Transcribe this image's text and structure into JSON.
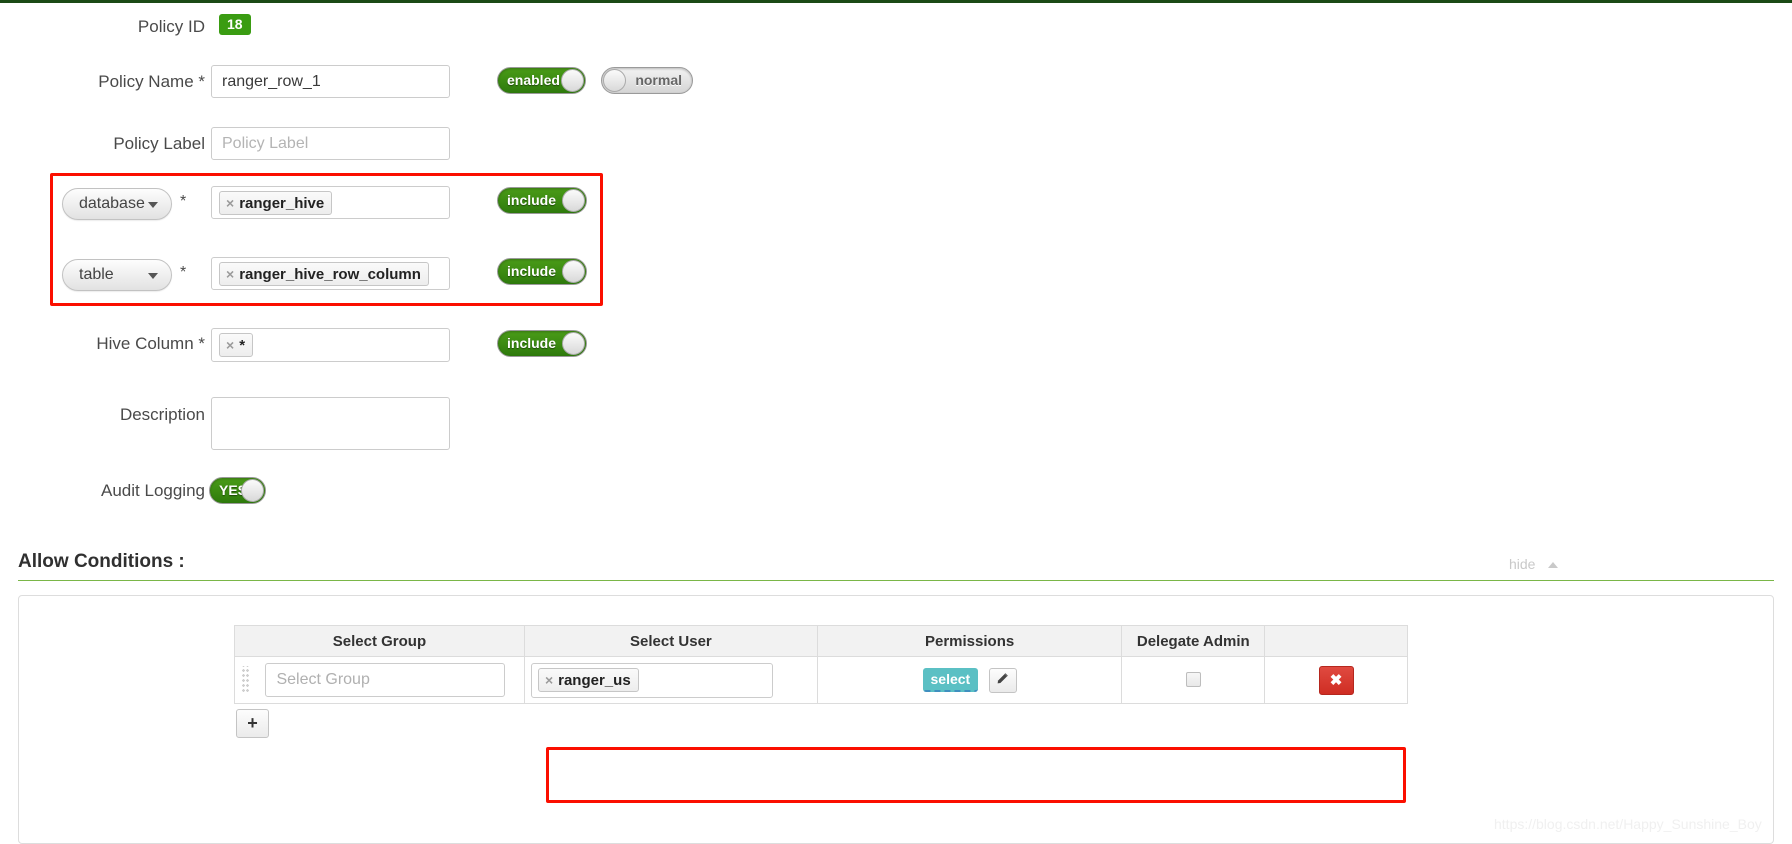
{
  "form": {
    "policy_id": {
      "label": "Policy ID",
      "value": "18"
    },
    "policy_name": {
      "label": "Policy Name *",
      "value": "ranger_row_1"
    },
    "policy_label": {
      "label": "Policy Label",
      "placeholder": "Policy Label",
      "value": ""
    },
    "description": {
      "label": "Description",
      "value": ""
    },
    "audit_logging": {
      "label": "Audit Logging",
      "toggle": "YES"
    },
    "status_toggle": {
      "label": "enabled"
    },
    "priority_toggle": {
      "label": "normal"
    },
    "resources": [
      {
        "type": "database",
        "required": "*",
        "chip": "ranger_hive",
        "chip_remove": "×",
        "toggle": "include"
      },
      {
        "type": "table",
        "required": "*",
        "chip": "ranger_hive_row_column",
        "chip_remove": "×",
        "toggle": "include"
      }
    ],
    "hive_column": {
      "label": "Hive Column *",
      "chip": "*",
      "chip_remove": "×",
      "toggle": "include"
    }
  },
  "allow_conditions": {
    "title": "Allow Conditions :",
    "hide_label": "hide",
    "columns": [
      "Select Group",
      "Select User",
      "Permissions",
      "Delegate Admin",
      ""
    ],
    "rows": [
      {
        "group_placeholder": "Select Group",
        "group_value": "",
        "user_chip": "ranger_us",
        "user_chip_remove": "×",
        "permission": "select",
        "edit_icon": "pencil-icon",
        "delegate_admin_checked": false,
        "delete_label": "✖"
      }
    ],
    "add_label": "+"
  },
  "watermark": "https://blog.csdn.net/Happy_Sunshine_Boy",
  "colors": {
    "accent_green": "#3a9c12",
    "toggle_on": "#2e7a0c",
    "annotation_red": "#fb0f00",
    "permission_badge": "#5bc0c4",
    "delete_red": "#cf2d23",
    "rule_green": "#7ab648"
  }
}
